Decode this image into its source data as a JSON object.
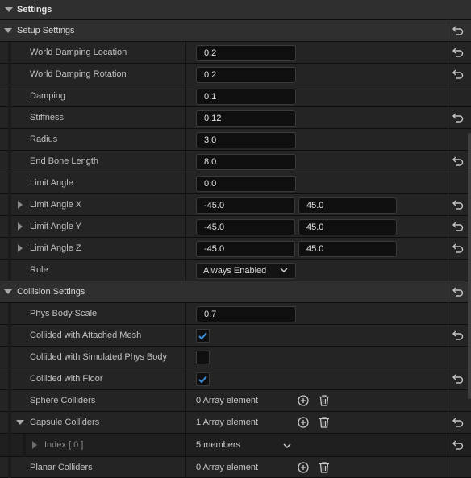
{
  "header": {
    "title": "Settings"
  },
  "setup": {
    "title": "Setup Settings",
    "world_damping_location": {
      "label": "World Damping Location",
      "value": "0.2"
    },
    "world_damping_rotation": {
      "label": "World Damping Rotation",
      "value": "0.2"
    },
    "damping": {
      "label": "Damping",
      "value": "0.1"
    },
    "stiffness": {
      "label": "Stiffness",
      "value": "0.12"
    },
    "radius": {
      "label": "Radius",
      "value": "3.0"
    },
    "end_bone_length": {
      "label": "End Bone Length",
      "value": "8.0"
    },
    "limit_angle": {
      "label": "Limit Angle",
      "value": "0.0"
    },
    "limit_angle_x": {
      "label": "Limit Angle X",
      "min": "-45.0",
      "max": "45.0"
    },
    "limit_angle_y": {
      "label": "Limit Angle Y",
      "min": "-45.0",
      "max": "45.0"
    },
    "limit_angle_z": {
      "label": "Limit Angle Z",
      "min": "-45.0",
      "max": "45.0"
    },
    "rule": {
      "label": "Rule",
      "value": "Always Enabled"
    }
  },
  "collision": {
    "title": "Collision Settings",
    "phys_body_scale": {
      "label": "Phys Body Scale",
      "value": "0.7"
    },
    "attached_mesh": {
      "label": "Collided with Attached Mesh",
      "checked": true
    },
    "simulated_phys_body": {
      "label": "Collided with Simulated Phys Body",
      "checked": false
    },
    "floor": {
      "label": "Collided with Floor",
      "checked": true
    },
    "sphere_colliders": {
      "label": "Sphere Colliders",
      "count": "0 Array element"
    },
    "capsule_colliders": {
      "label": "Capsule Colliders",
      "count": "1 Array element"
    },
    "capsule_index0": {
      "label": "Index [ 0 ]",
      "members": "5 members"
    },
    "planar_colliders": {
      "label": "Planar Colliders",
      "count": "0 Array element"
    }
  },
  "colors": {
    "accent": "#3d8fdd",
    "background": "#151515"
  },
  "icons": {
    "reset": "reset-arrow-icon",
    "add": "plus-circle-icon",
    "delete": "trash-icon"
  }
}
